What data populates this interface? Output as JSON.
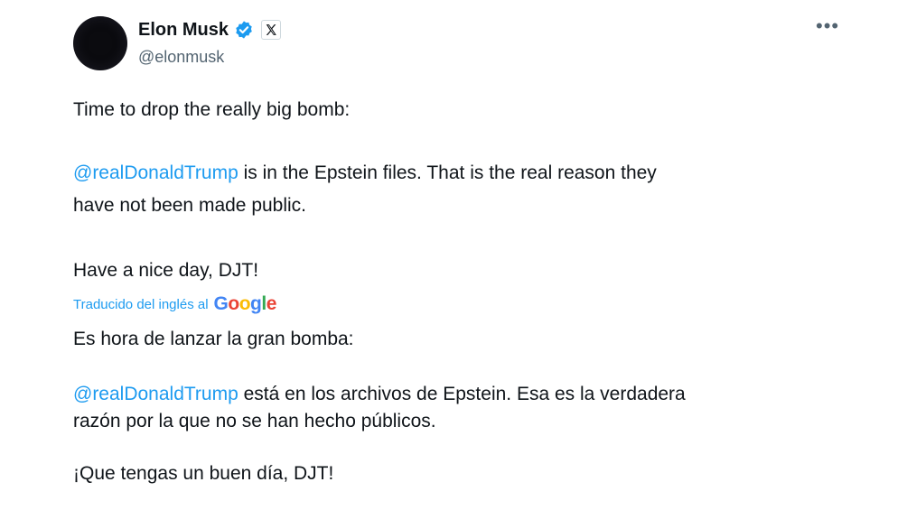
{
  "author": {
    "name": "Elon Musk",
    "handle": "@elonmusk",
    "verified_icon": "verified-badge-icon",
    "affiliation_icon": "x-logo-icon"
  },
  "menu": {
    "more_label": "•••"
  },
  "original": {
    "line1": "Time to drop the really big bomb:",
    "mention": "@realDonaldTrump",
    "line2_rest": " is in the Epstein files. That is the real reason they",
    "line3": "have not been made public.",
    "line4": "Have a nice day, DJT!"
  },
  "translation": {
    "label": "Traducido del inglés al",
    "provider_logo_text": "Google",
    "line1": "Es hora de lanzar la gran bomba:",
    "mention": "@realDonaldTrump",
    "line2_rest": " está en los archivos de Epstein. Esa es la verdadera",
    "line3": "razón por la que no se han hecho públicos.",
    "line4": "¡Que tengas un buen día, DJT!"
  },
  "colors": {
    "link": "#1d9bf0",
    "text": "#0f1419",
    "secondary": "#536471"
  }
}
